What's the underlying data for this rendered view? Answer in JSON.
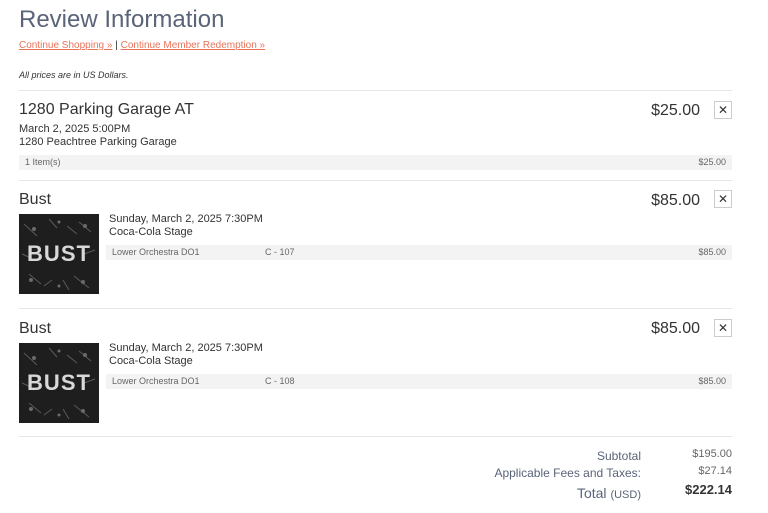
{
  "header": {
    "title": "Review Information",
    "continue_shopping": "Continue Shopping »",
    "separator": "|",
    "continue_redemption": "Continue Member Redemption »",
    "currency_note": "All prices are in US Dollars."
  },
  "items": [
    {
      "name": "1280 Parking Garage AT",
      "price": "$25.00",
      "remove": "✕",
      "date": "March 2, 2025 5:00PM",
      "location": "1280 Peachtree Parking Garage",
      "summary_label": "1 Item(s)",
      "summary_price": "$25.00"
    },
    {
      "name": "Bust",
      "price": "$85.00",
      "remove": "✕",
      "thumb_text": "BUST",
      "date": "Sunday, March 2, 2025 7:30PM",
      "venue": "Coca-Cola Stage",
      "section": "Lower Orchestra DO1",
      "seat": "C - 107",
      "seat_price": "$85.00"
    },
    {
      "name": "Bust",
      "price": "$85.00",
      "remove": "✕",
      "thumb_text": "BUST",
      "date": "Sunday, March 2, 2025 7:30PM",
      "venue": "Coca-Cola Stage",
      "section": "Lower Orchestra DO1",
      "seat": "C - 108",
      "seat_price": "$85.00"
    }
  ],
  "totals": {
    "subtotal_label": "Subtotal",
    "subtotal_value": "$195.00",
    "fees_label": "Applicable Fees and Taxes:",
    "fees_value": "$27.14",
    "total_label": "Total",
    "total_currency": "(USD)",
    "total_value": "$222.14"
  },
  "colors": {
    "link": "#e8735a",
    "title": "#5a6478",
    "row_bg": "#f3f3f3"
  }
}
